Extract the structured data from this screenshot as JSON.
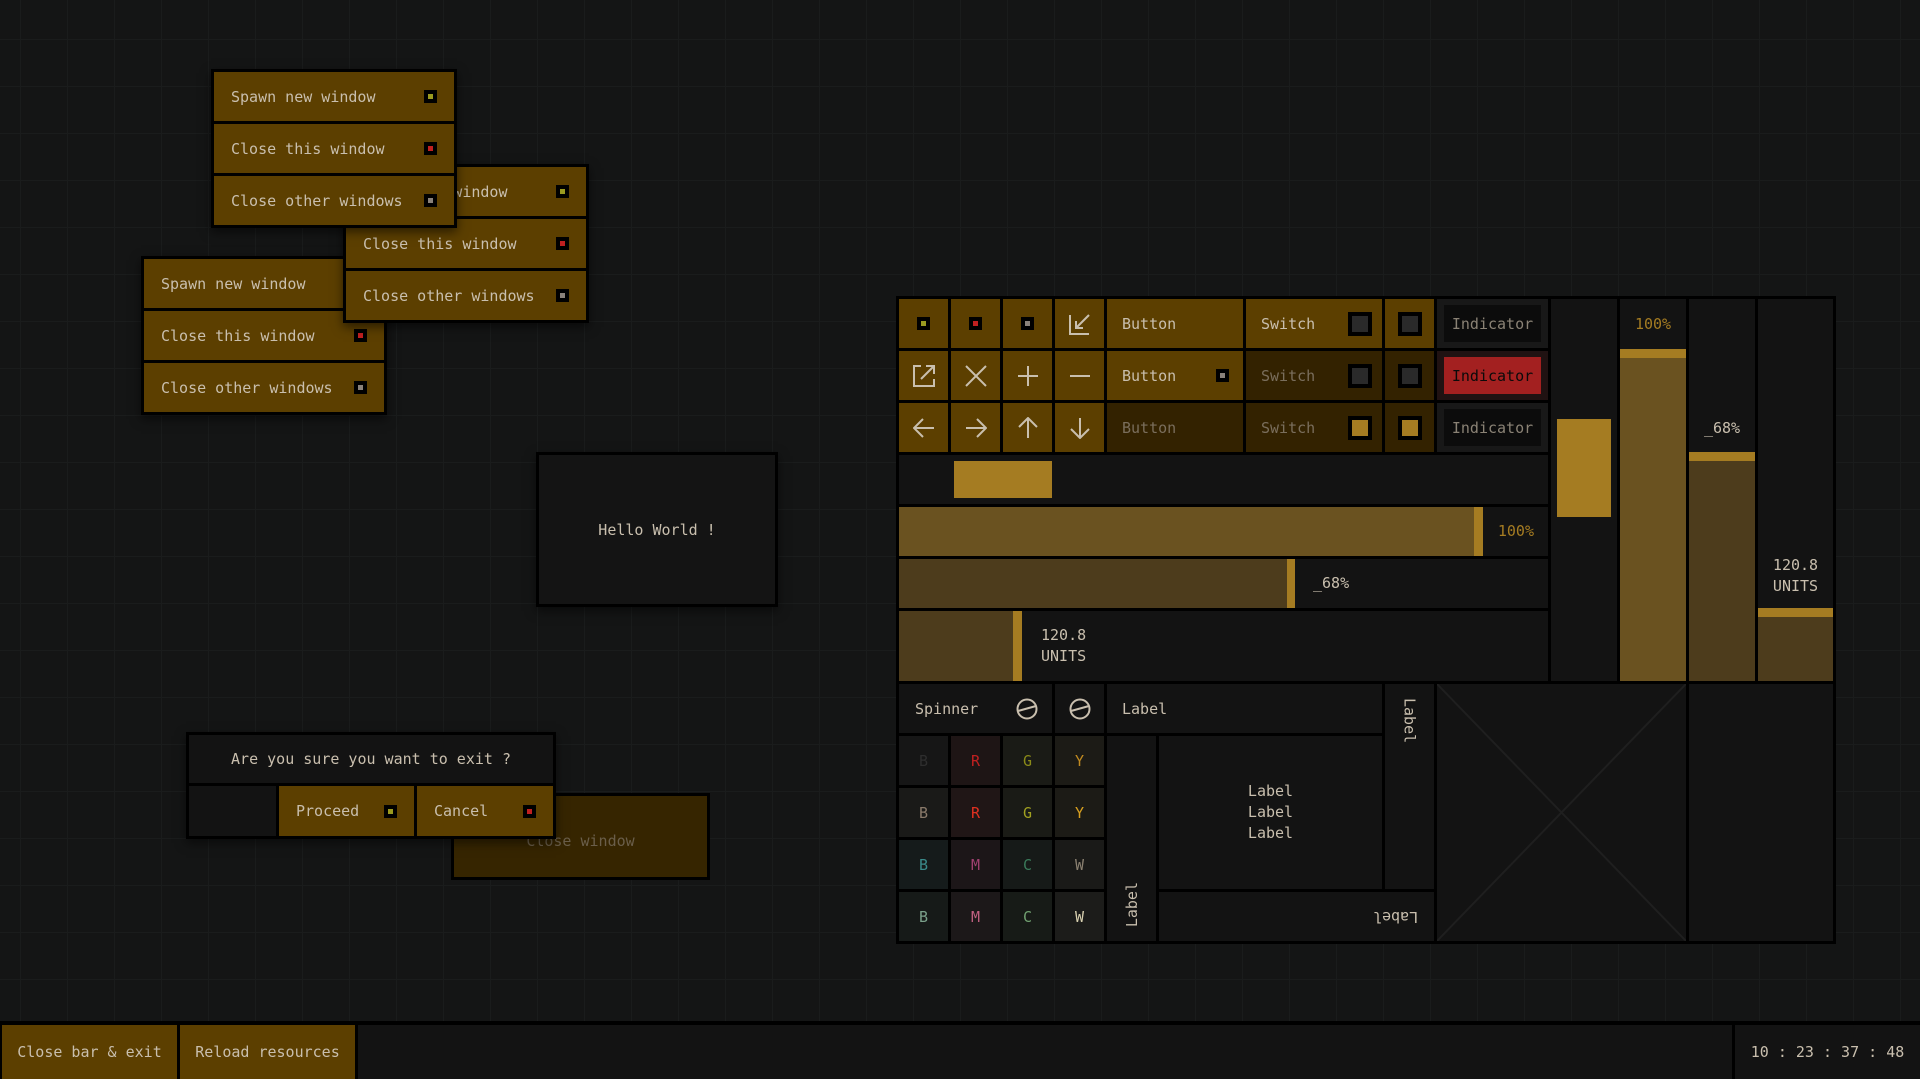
{
  "windows": [
    {
      "items": [
        {
          "label": "Spawn new window",
          "dot": "#9a9a20"
        },
        {
          "label": "Close this window",
          "dot": "#c02020"
        },
        {
          "label": "Close other windows",
          "dot": "#8a827a"
        }
      ]
    },
    {
      "items": [
        {
          "label": "Spawn new window",
          "dot": "#9a9a20"
        },
        {
          "label": "Close this window",
          "dot": "#c02020"
        },
        {
          "label": "Close other windows",
          "dot": "#8a827a"
        }
      ]
    },
    {
      "items": [
        {
          "label": "Spawn new window",
          "dot": "#9a9a20"
        },
        {
          "label": "Close this window",
          "dot": "#c02020"
        },
        {
          "label": "Close other windows",
          "dot": "#8a827a"
        }
      ]
    }
  ],
  "hello": "Hello World !",
  "behind_window": {
    "label": "Close window"
  },
  "dialog": {
    "message": "Are you sure you want to exit ?",
    "proceed": "Proceed",
    "cancel": "Cancel",
    "proceed_dot": "#9a9a20",
    "cancel_dot": "#c02020"
  },
  "panel": {
    "dots": [
      "#9a9a20",
      "#c02020",
      "#8a827a"
    ],
    "icons": [
      "arrow-in-icon",
      "external-link-icon",
      "close-icon",
      "plus-icon",
      "minus-icon",
      "arrow-left-icon",
      "arrow-right-icon",
      "arrow-up-icon",
      "arrow-down-icon"
    ],
    "buttons": [
      {
        "label": "Button",
        "state": "normal"
      },
      {
        "label": "Button",
        "state": "normal",
        "dot": "#8a827a"
      },
      {
        "label": "Button",
        "state": "disabled"
      }
    ],
    "switches": [
      {
        "label": "Switch",
        "on": false
      },
      {
        "label": "Switch",
        "on": false,
        "disabled": true
      },
      {
        "label": "Switch",
        "on": true,
        "disabled": true
      }
    ],
    "indicators": [
      {
        "label": "Indicator",
        "active": false
      },
      {
        "label": "Indicator",
        "active": true
      },
      {
        "label": "Indicator",
        "active": false
      }
    ],
    "slider_h": 0.09,
    "slider_v": 0.42,
    "bars_h": [
      {
        "text": "100%",
        "fill": 0.9
      },
      {
        "text": "_68%",
        "fill": 0.61
      },
      {
        "value": "120.8",
        "unit": "UNITS",
        "fill": 0.19
      }
    ],
    "bars_v": [
      {
        "text": "100%",
        "fill": 0.87
      },
      {
        "text": "_68%",
        "fill": 0.6
      },
      {
        "value": "120.8",
        "unit": "UNITS",
        "fill": 0.19
      }
    ],
    "spinner_label": "Spinner",
    "label": "Label",
    "multi_label": [
      "Label",
      "Label",
      "Label"
    ],
    "color_grid": [
      [
        {
          "t": "B",
          "c": "#2e2e2e",
          "bg": "#161616"
        },
        {
          "t": "R",
          "c": "#c02020",
          "bg": "#1e1515"
        },
        {
          "t": "G",
          "c": "#8a8a18",
          "bg": "#1a1b16"
        },
        {
          "t": "Y",
          "c": "#c08a20",
          "bg": "#1c1b16"
        }
      ],
      [
        {
          "t": "B",
          "c": "#8a7a6a",
          "bg": "#1a1a18"
        },
        {
          "t": "R",
          "c": "#e03020",
          "bg": "#201616"
        },
        {
          "t": "G",
          "c": "#a0a020",
          "bg": "#1a1b16"
        },
        {
          "t": "Y",
          "c": "#d8a020",
          "bg": "#1c1b16"
        }
      ],
      [
        {
          "t": "B",
          "c": "#3a8a8a",
          "bg": "#151b1b"
        },
        {
          "t": "M",
          "c": "#a04070",
          "bg": "#1c1618"
        },
        {
          "t": "C",
          "c": "#3a7a5a",
          "bg": "#161a18"
        },
        {
          "t": "W",
          "c": "#8a8070",
          "bg": "#1a1a18"
        }
      ],
      [
        {
          "t": "B",
          "c": "#7aa08a",
          "bg": "#161a18"
        },
        {
          "t": "M",
          "c": "#c06080",
          "bg": "#1c1819"
        },
        {
          "t": "C",
          "c": "#70a070",
          "bg": "#171b17"
        },
        {
          "t": "W",
          "c": "#d8d0b0",
          "bg": "#1c1c1a"
        }
      ]
    ]
  },
  "taskbar": {
    "close_bar": "Close bar & exit",
    "reload": "Reload resources",
    "clock": "10 : 23 : 37 : 48"
  },
  "colors": {
    "accent": "#5c3f00",
    "gold": "#a57c22",
    "alert": "#a32020"
  }
}
